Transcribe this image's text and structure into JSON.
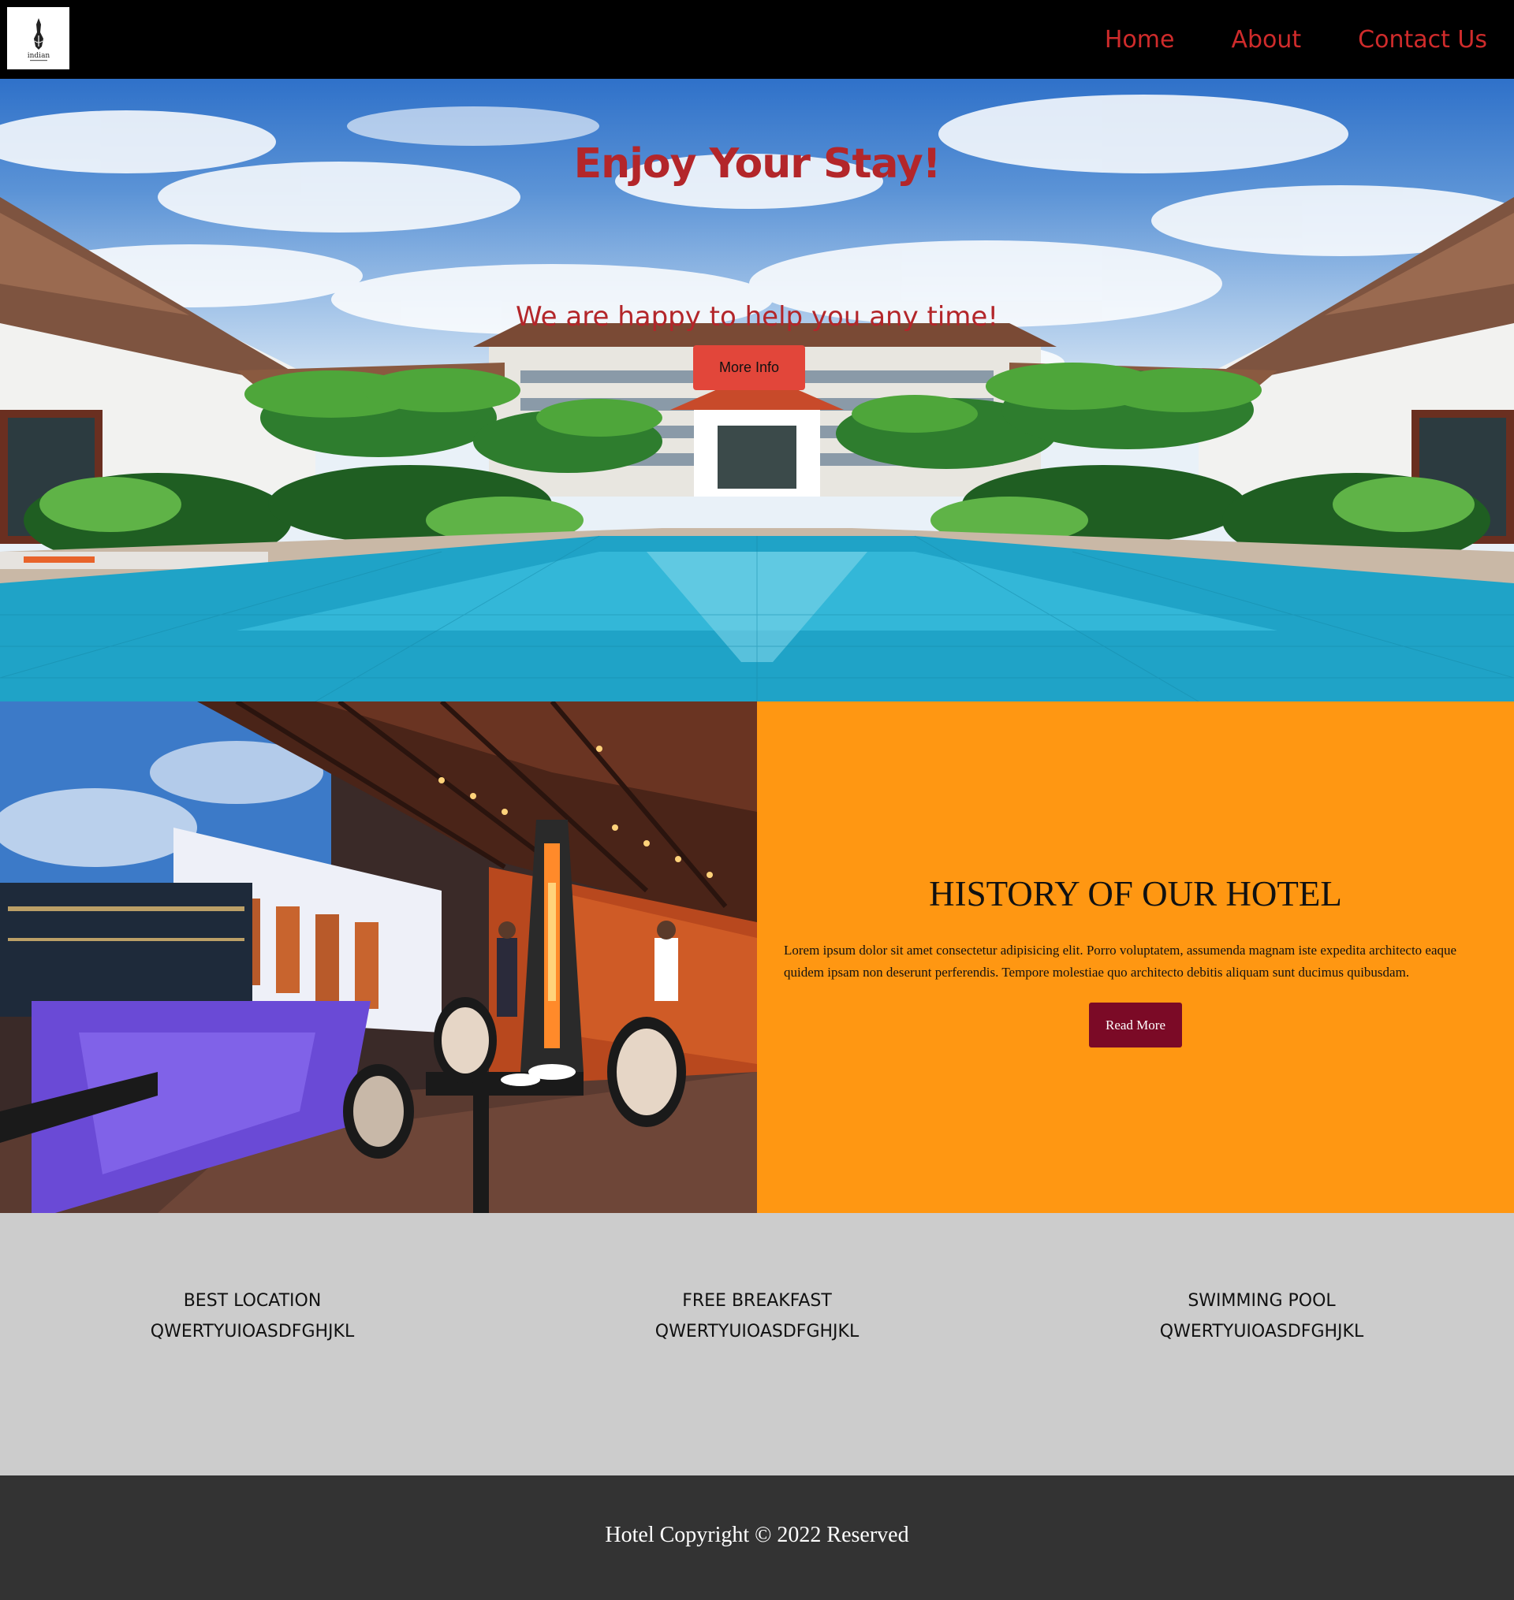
{
  "nav": {
    "logo_alt": "indian",
    "links": [
      {
        "label": "Home"
      },
      {
        "label": "About"
      },
      {
        "label": "Contact Us"
      }
    ],
    "link_color": "#cf2b2b"
  },
  "hero": {
    "title": "Enjoy Your Stay!",
    "subtitle": "We are happy to help you any time!",
    "button_label": "More Info",
    "text_color": "#b3262a",
    "button_color": "#e2463a"
  },
  "history": {
    "title": "HISTORY OF OUR HOTEL",
    "text": "Lorem ipsum dolor sit amet consectetur adipisicing elit. Porro voluptatem, assumenda magnam iste expedita architecto eaque quidem ipsam non deserunt perferendis. Tempore molestiae quo architecto debitis aliquam sunt ducimus quibusdam.",
    "button_label": "Read More",
    "background": "#ff9712",
    "button_color": "#7b0a26"
  },
  "features": [
    {
      "title": "BEST LOCATION",
      "text": "QWERTYUIOASDFGHJKL"
    },
    {
      "title": "FREE BREAKFAST",
      "text": "QWERTYUIOASDFGHJKL"
    },
    {
      "title": "SWIMMING POOL",
      "text": "QWERTYUIOASDFGHJKL"
    }
  ],
  "footer": {
    "text": "Hotel Copyright © 2022 Reserved"
  }
}
